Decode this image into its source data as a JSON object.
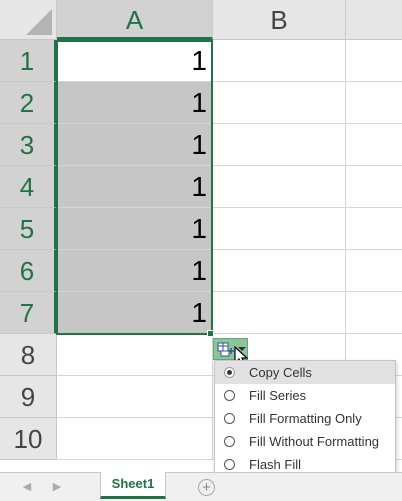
{
  "columns": [
    "A",
    "B"
  ],
  "rows": [
    "1",
    "2",
    "3",
    "4",
    "5",
    "6",
    "7",
    "8",
    "9",
    "10"
  ],
  "cells": {
    "A1": "1",
    "A2": "1",
    "A3": "1",
    "A4": "1",
    "A5": "1",
    "A6": "1",
    "A7": "1"
  },
  "autofill_menu": {
    "items": [
      {
        "label": "Copy Cells",
        "selected": true
      },
      {
        "label": "Fill Series",
        "selected": false
      },
      {
        "label": "Fill Formatting Only",
        "selected": false
      },
      {
        "label": "Fill Without Formatting",
        "selected": false
      },
      {
        "label": "Flash Fill",
        "selected": false
      }
    ]
  },
  "sheet_tabs": {
    "active": "Sheet1",
    "add_icon": "+"
  },
  "colors": {
    "accent": "#217346",
    "selection": "#c6c6c6",
    "autofill_button": "#8fc49a"
  }
}
